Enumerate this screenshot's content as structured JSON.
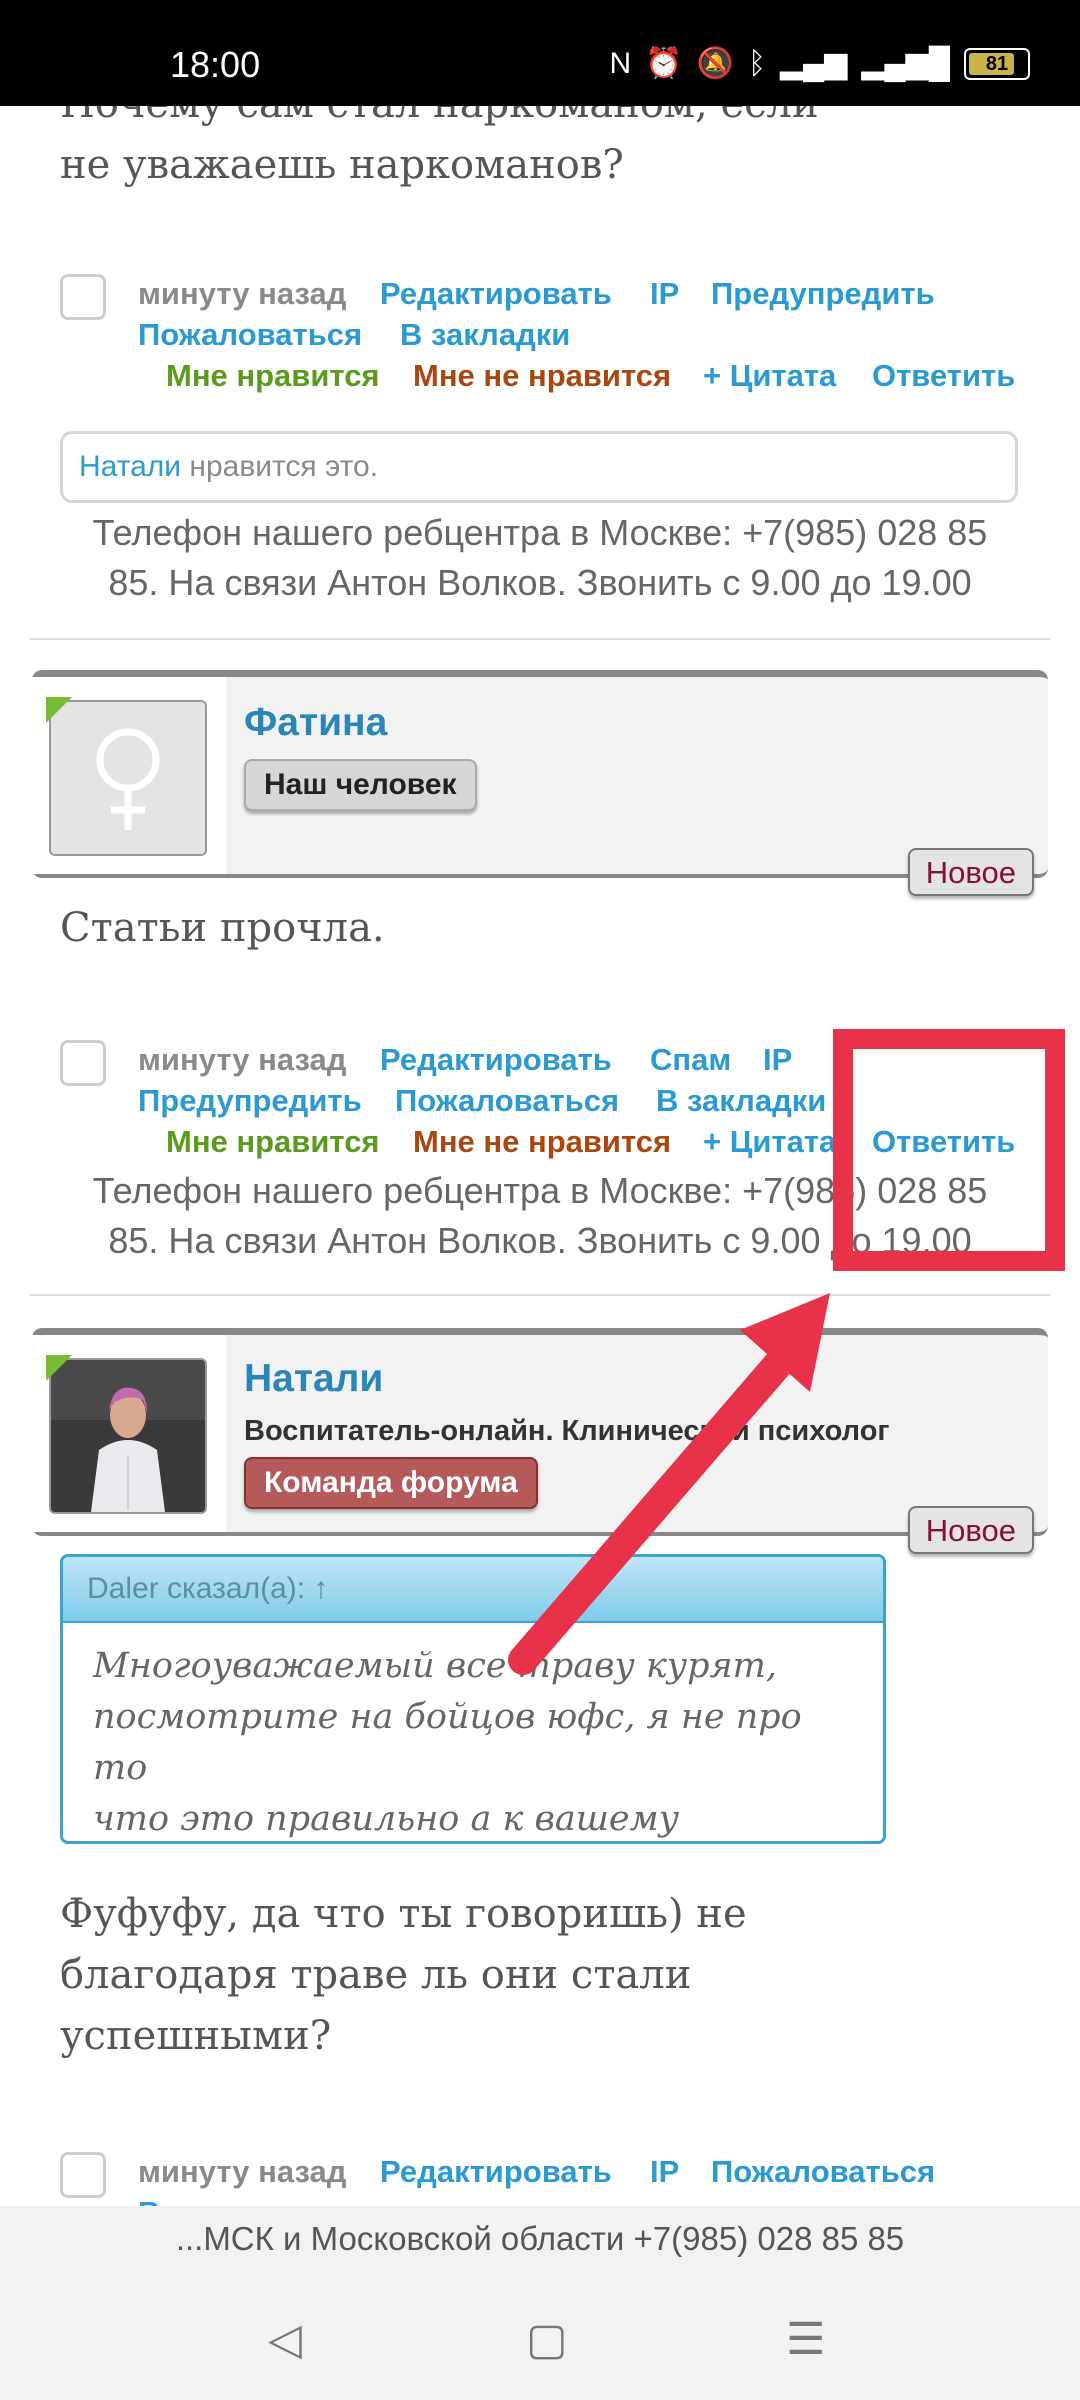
{
  "status": {
    "time": "18:00",
    "battery": "81",
    "battery_level": 0.81
  },
  "post1": {
    "text_line1": "Почему сам стал наркоманом, если",
    "text_line2": "не уважаешь наркоманов?",
    "meta": {
      "time": "минуту назад",
      "edit": "Редактировать",
      "ip": "IP",
      "warn": "Предупредить",
      "report": "Пожаловаться",
      "bookmark": "В закладки",
      "like": "Мне нравится",
      "dislike": "Мне не нравится",
      "quote": "+ Цитата",
      "reply": "Ответить"
    },
    "likes_user": "Натали",
    "likes_text": " нравится это.",
    "phone_line1": "Телефон нашего ребцентра в Москве: +7(985) 028 85",
    "phone_line2": "85. На связи Антон Волков. Звонить с 9.00 до 19.00"
  },
  "user1": {
    "name": "Фатина",
    "rank": "Наш человек",
    "badge": "Новое"
  },
  "post2": {
    "text": "Статьи прочла.",
    "meta": {
      "time": "минуту назад",
      "edit": "Редактировать",
      "spam": "Спам",
      "ip": "IP",
      "warn": "Предупредить",
      "report": "Пожаловаться",
      "bookmark": "В закладки",
      "like": "Мне нравится",
      "dislike": "Мне не нравится",
      "quote": "+ Цитата",
      "reply": "Ответить"
    },
    "phone_line1": "Телефон нашего ребцентра в Москве: +7(985) 028 85",
    "phone_line2": "85. На связи Антон Волков. Звонить с 9.00 до 19.00"
  },
  "user2": {
    "name": "Натали",
    "subtitle": "Воспитатель-онлайн. Клинический психолог",
    "rank": "Команда форума",
    "badge": "Новое"
  },
  "quote": {
    "author": "Daler сказал(а): ↑",
    "line1": "Многоуважаемый все траву курят,",
    "line2": "посмотрите на бойцов юфс, я не про то",
    "line3": "что это правильно а к вашему сомнению"
  },
  "post3": {
    "line1": "Фуфуфу, да что ты говоришь) не",
    "line2": "благодаря траве ль они стали",
    "line3": "успешными?",
    "meta": {
      "time": "минуту назад",
      "edit": "Редактировать",
      "ip": "IP",
      "report": "Пожаловаться",
      "bookmark": "В закладки"
    }
  },
  "footer": {
    "text": "...МСК и Московской области +7(985) 028 85 85"
  },
  "colors": {
    "link": "#2a9ad0",
    "like": "#5a9a1c",
    "dislike": "#a9470f",
    "highlight": "#e8324a"
  }
}
